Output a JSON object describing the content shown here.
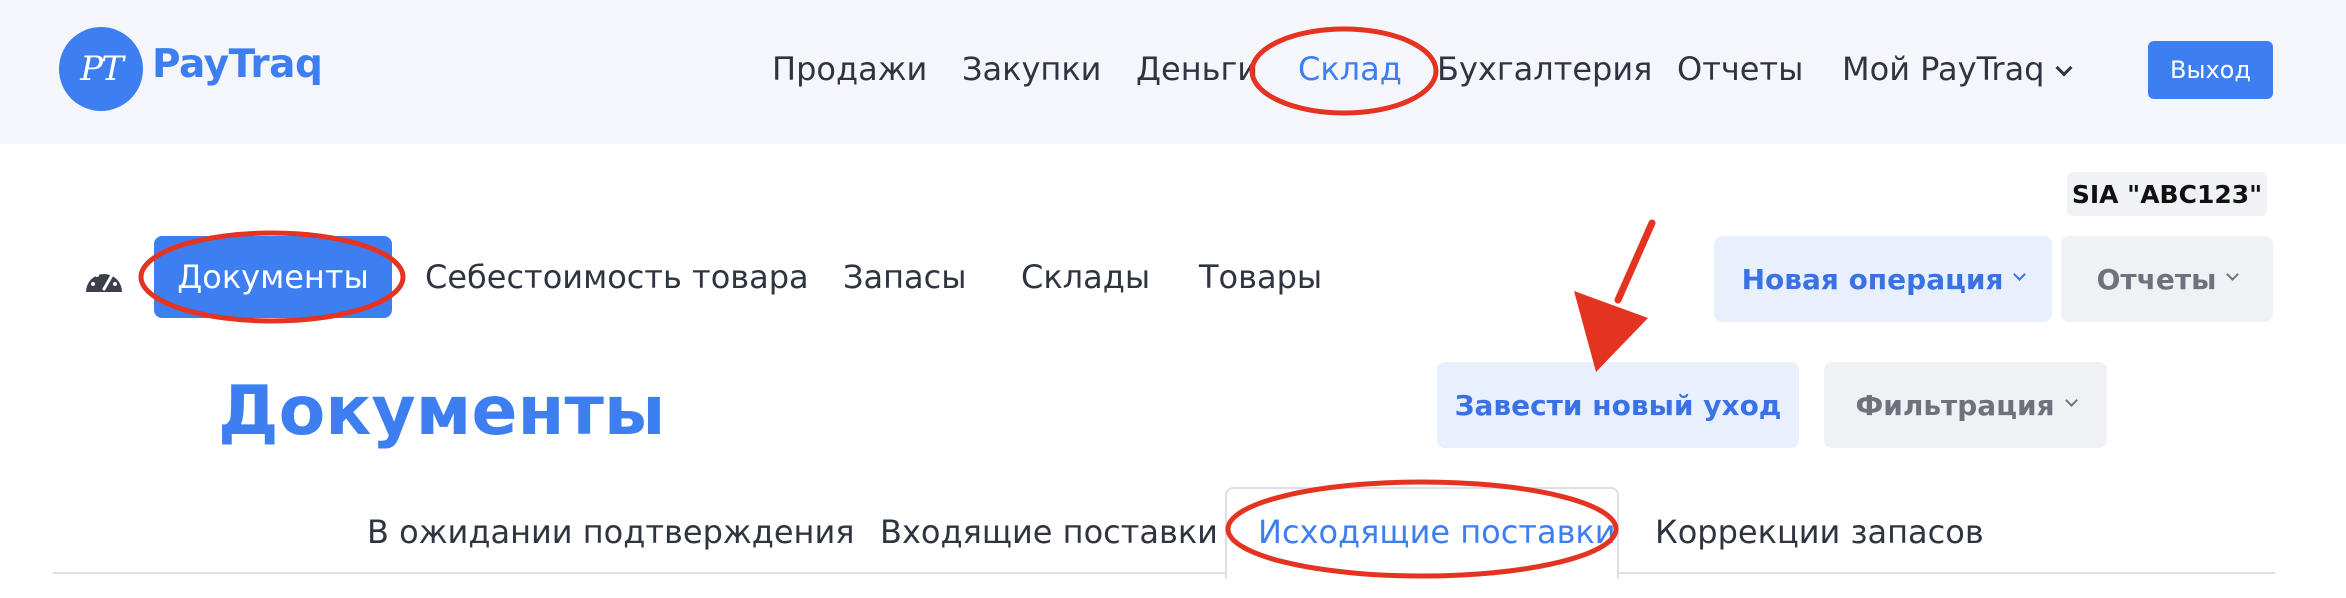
{
  "brand": {
    "logo_mark": "PT",
    "name": "PayTraq",
    "color": "#3d7ff0"
  },
  "top_nav": {
    "items": [
      {
        "label": "Продажи"
      },
      {
        "label": "Закупки"
      },
      {
        "label": "Деньги"
      },
      {
        "label": "Склад",
        "active": true
      },
      {
        "label": "Бухгалтерия"
      },
      {
        "label": "Отчеты"
      },
      {
        "label": "Мой PayTraq",
        "has_dropdown": true
      }
    ],
    "logout_label": "Выход"
  },
  "company_badge": "SIA \"ABC123\"",
  "sub_nav": {
    "dashboard_icon": "gauge-icon",
    "items": [
      {
        "label": "Документы",
        "active": true
      },
      {
        "label": "Себестоимость товара"
      },
      {
        "label": "Запасы"
      },
      {
        "label": "Склады"
      },
      {
        "label": "Товары"
      }
    ],
    "new_operation_label": "Новая операция",
    "reports_label": "Отчеты"
  },
  "main": {
    "title": "Документы",
    "new_outgoing_label": "Завести новый уход",
    "filter_label": "Фильтрация",
    "tabs": [
      {
        "label": "В ожидании подтверждения"
      },
      {
        "label": "Входящие поставки"
      },
      {
        "label": "Исходящие поставки",
        "active": true
      },
      {
        "label": "Коррекции запасов"
      }
    ]
  },
  "annotations": {
    "highlight_color": "#e53322",
    "circled": [
      "Склад",
      "Документы",
      "Исходящие поставки"
    ],
    "arrow_target": "Завести новый уход"
  }
}
